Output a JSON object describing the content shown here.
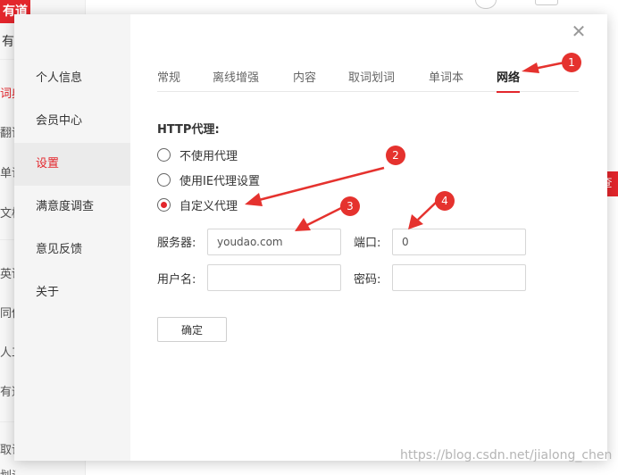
{
  "background": {
    "logo_text": "有道",
    "app_title": "有",
    "nav_items": [
      "词典",
      "翻译",
      "单词",
      "文档",
      "英语",
      "同传",
      "人工",
      "有道",
      "取词",
      "划词"
    ],
    "active_nav_index": 0,
    "search_button": "查"
  },
  "dialog": {
    "sidebar": [
      {
        "label": "个人信息",
        "active": false
      },
      {
        "label": "会员中心",
        "active": false
      },
      {
        "label": "设置",
        "active": true
      },
      {
        "label": "满意度调查",
        "active": false
      },
      {
        "label": "意见反馈",
        "active": false
      },
      {
        "label": "关于",
        "active": false
      }
    ],
    "close_glyph": "✕",
    "tabs": [
      {
        "label": "常规",
        "active": false
      },
      {
        "label": "离线增强",
        "active": false
      },
      {
        "label": "内容",
        "active": false
      },
      {
        "label": "取词划词",
        "active": false
      },
      {
        "label": "单词本",
        "active": false
      },
      {
        "label": "网络",
        "active": true
      }
    ],
    "section_title": "HTTP代理:",
    "proxy_options": [
      {
        "label": "不使用代理",
        "checked": false
      },
      {
        "label": "使用IE代理设置",
        "checked": false
      },
      {
        "label": "自定义代理",
        "checked": true
      }
    ],
    "fields": {
      "server_label": "服务器:",
      "server_value": "youdao.com",
      "port_label": "端口:",
      "port_value": "0",
      "username_label": "用户名:",
      "username_value": "",
      "password_label": "密码:",
      "password_value": ""
    },
    "confirm_label": "确定"
  },
  "annotations": {
    "badges": [
      "1",
      "2",
      "3",
      "4"
    ],
    "arrow_color": "#e5322e"
  },
  "watermark": "https://blog.csdn.net/jialong_chen",
  "colors": {
    "accent": "#e3262c",
    "annotation": "#e5322e"
  }
}
